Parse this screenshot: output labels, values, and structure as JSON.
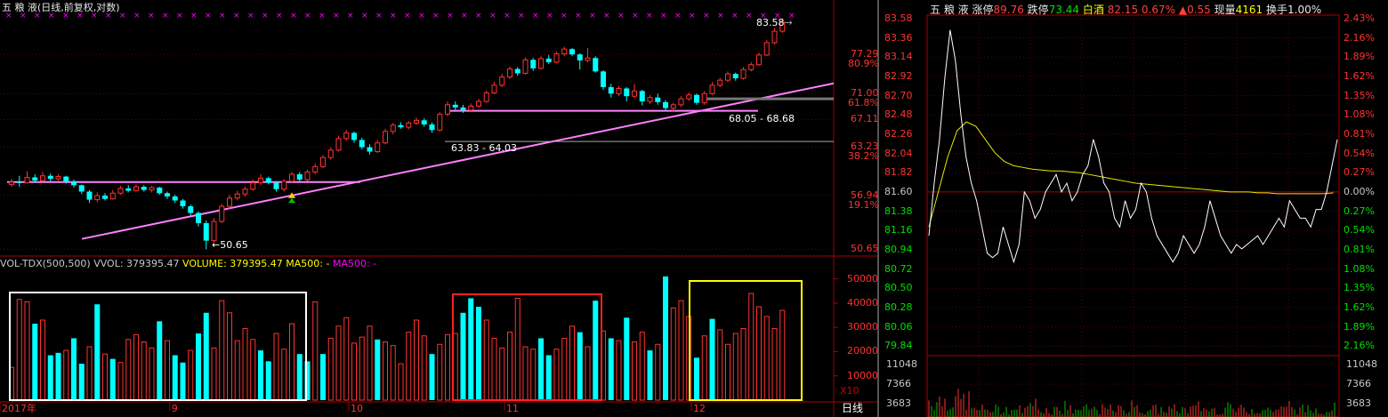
{
  "header": {
    "stock": "五 粮 液",
    "mode": "(日线,前复权,对数)"
  },
  "kline": {
    "high_label": "83.58",
    "low_label": "50.65",
    "zone1_label": "63.83 - 64.03",
    "zone2_label": "68.05 - 68.68",
    "price_axis": [
      {
        "price": "77.29",
        "pct": "80.9%"
      },
      {
        "price": "71.00",
        "pct": "61.8%"
      },
      {
        "price": "67.11",
        "pct": ""
      },
      {
        "price": "63.23",
        "pct": "38.2%"
      },
      {
        "price": "56.94",
        "pct": "19.1%"
      },
      {
        "price": "50.65",
        "pct": ""
      }
    ],
    "candles": [
      {
        "o": 58.3,
        "c": 58.6,
        "h": 59.0,
        "l": 58.0
      },
      {
        "o": 58.6,
        "c": 58.5,
        "h": 59.4,
        "l": 58.0
      },
      {
        "o": 58.5,
        "c": 59.2,
        "h": 60.0,
        "l": 58.4
      },
      {
        "o": 59.2,
        "c": 58.8,
        "h": 59.6,
        "l": 58.5
      },
      {
        "o": 58.8,
        "c": 59.4,
        "h": 59.9,
        "l": 58.6
      },
      {
        "o": 59.4,
        "c": 59.0,
        "h": 59.7,
        "l": 58.7
      },
      {
        "o": 59.0,
        "c": 59.3,
        "h": 59.6,
        "l": 58.8
      },
      {
        "o": 59.3,
        "c": 58.7,
        "h": 59.4,
        "l": 58.4
      },
      {
        "o": 58.7,
        "c": 58.2,
        "h": 58.9,
        "l": 57.9
      },
      {
        "o": 58.2,
        "c": 57.4,
        "h": 58.3,
        "l": 57.1
      },
      {
        "o": 57.4,
        "c": 56.4,
        "h": 57.6,
        "l": 56.0
      },
      {
        "o": 56.4,
        "c": 56.9,
        "h": 57.3,
        "l": 56.1
      },
      {
        "o": 56.9,
        "c": 56.5,
        "h": 57.2,
        "l": 56.3
      },
      {
        "o": 56.5,
        "c": 57.2,
        "h": 57.6,
        "l": 56.4
      },
      {
        "o": 57.2,
        "c": 57.8,
        "h": 58.1,
        "l": 57.0
      },
      {
        "o": 57.8,
        "c": 57.5,
        "h": 58.2,
        "l": 57.3
      },
      {
        "o": 57.5,
        "c": 58.0,
        "h": 58.3,
        "l": 57.4
      },
      {
        "o": 58.0,
        "c": 57.6,
        "h": 58.2,
        "l": 57.4
      },
      {
        "o": 57.6,
        "c": 57.9,
        "h": 58.1,
        "l": 57.3
      },
      {
        "o": 57.9,
        "c": 57.2,
        "h": 58.0,
        "l": 57.0
      },
      {
        "o": 57.2,
        "c": 56.8,
        "h": 57.4,
        "l": 56.5
      },
      {
        "o": 56.8,
        "c": 56.3,
        "h": 57.0,
        "l": 56.0
      },
      {
        "o": 56.3,
        "c": 55.6,
        "h": 56.5,
        "l": 55.3
      },
      {
        "o": 55.6,
        "c": 54.8,
        "h": 55.8,
        "l": 54.5
      },
      {
        "o": 54.8,
        "c": 53.6,
        "h": 55.0,
        "l": 53.2
      },
      {
        "o": 53.6,
        "c": 51.6,
        "h": 53.9,
        "l": 50.65
      },
      {
        "o": 51.6,
        "c": 53.8,
        "h": 54.2,
        "l": 51.4
      },
      {
        "o": 53.8,
        "c": 55.6,
        "h": 55.9,
        "l": 53.6
      },
      {
        "o": 55.6,
        "c": 56.6,
        "h": 57.0,
        "l": 55.3
      },
      {
        "o": 56.6,
        "c": 57.1,
        "h": 57.5,
        "l": 56.3
      },
      {
        "o": 57.1,
        "c": 57.7,
        "h": 58.0,
        "l": 56.8
      },
      {
        "o": 57.7,
        "c": 58.5,
        "h": 58.9,
        "l": 57.5
      },
      {
        "o": 58.5,
        "c": 59.1,
        "h": 59.6,
        "l": 58.2
      },
      {
        "o": 59.1,
        "c": 58.5,
        "h": 59.3,
        "l": 58.3
      },
      {
        "o": 58.5,
        "c": 57.7,
        "h": 58.7,
        "l": 57.4
      },
      {
        "o": 57.7,
        "c": 58.7,
        "h": 59.0,
        "l": 57.4
      },
      {
        "o": 58.7,
        "c": 59.6,
        "h": 59.9,
        "l": 58.5
      },
      {
        "o": 59.6,
        "c": 58.9,
        "h": 59.9,
        "l": 58.6
      },
      {
        "o": 58.9,
        "c": 59.9,
        "h": 60.2,
        "l": 58.7
      },
      {
        "o": 59.9,
        "c": 60.6,
        "h": 61.0,
        "l": 59.6
      },
      {
        "o": 60.6,
        "c": 61.8,
        "h": 62.1,
        "l": 60.4
      },
      {
        "o": 61.8,
        "c": 62.8,
        "h": 63.2,
        "l": 61.5
      },
      {
        "o": 62.8,
        "c": 64.4,
        "h": 64.8,
        "l": 62.6
      },
      {
        "o": 64.4,
        "c": 65.2,
        "h": 65.6,
        "l": 64.1
      },
      {
        "o": 65.2,
        "c": 64.2,
        "h": 65.4,
        "l": 63.8
      },
      {
        "o": 64.2,
        "c": 63.2,
        "h": 64.5,
        "l": 62.9
      },
      {
        "o": 63.2,
        "c": 62.6,
        "h": 63.6,
        "l": 62.2
      },
      {
        "o": 62.6,
        "c": 63.8,
        "h": 64.2,
        "l": 62.4
      },
      {
        "o": 63.8,
        "c": 65.4,
        "h": 65.8,
        "l": 63.6
      },
      {
        "o": 65.4,
        "c": 66.3,
        "h": 66.6,
        "l": 65.0
      },
      {
        "o": 66.3,
        "c": 66.0,
        "h": 66.7,
        "l": 65.8
      },
      {
        "o": 66.0,
        "c": 66.6,
        "h": 66.9,
        "l": 65.7
      },
      {
        "o": 66.6,
        "c": 67.0,
        "h": 67.4,
        "l": 66.3
      },
      {
        "o": 67.0,
        "c": 66.4,
        "h": 67.3,
        "l": 66.1
      },
      {
        "o": 66.4,
        "c": 65.6,
        "h": 66.7,
        "l": 65.2
      },
      {
        "o": 65.6,
        "c": 67.9,
        "h": 68.2,
        "l": 65.4
      },
      {
        "o": 67.9,
        "c": 69.3,
        "h": 69.8,
        "l": 67.6
      },
      {
        "o": 69.3,
        "c": 68.9,
        "h": 69.8,
        "l": 68.5
      },
      {
        "o": 68.9,
        "c": 68.5,
        "h": 69.3,
        "l": 68.1
      },
      {
        "o": 68.5,
        "c": 69.1,
        "h": 69.5,
        "l": 68.2
      },
      {
        "o": 69.1,
        "c": 69.8,
        "h": 70.2,
        "l": 68.9
      },
      {
        "o": 69.8,
        "c": 71.1,
        "h": 71.5,
        "l": 69.6
      },
      {
        "o": 71.1,
        "c": 72.3,
        "h": 72.8,
        "l": 70.9
      },
      {
        "o": 72.3,
        "c": 73.6,
        "h": 74.1,
        "l": 72.0
      },
      {
        "o": 73.6,
        "c": 74.9,
        "h": 75.3,
        "l": 73.3
      },
      {
        "o": 74.9,
        "c": 74.2,
        "h": 75.2,
        "l": 73.8
      },
      {
        "o": 74.2,
        "c": 76.4,
        "h": 76.8,
        "l": 74.0
      },
      {
        "o": 76.4,
        "c": 75.0,
        "h": 76.7,
        "l": 74.6
      },
      {
        "o": 75.0,
        "c": 76.6,
        "h": 77.0,
        "l": 74.8
      },
      {
        "o": 76.6,
        "c": 76.0,
        "h": 77.2,
        "l": 75.7
      },
      {
        "o": 76.0,
        "c": 77.4,
        "h": 77.8,
        "l": 75.8
      },
      {
        "o": 77.4,
        "c": 78.2,
        "h": 78.6,
        "l": 77.0
      },
      {
        "o": 78.2,
        "c": 77.3,
        "h": 78.4,
        "l": 77.0
      },
      {
        "o": 77.3,
        "c": 76.3,
        "h": 77.5,
        "l": 74.8
      },
      {
        "o": 76.3,
        "c": 76.7,
        "h": 78.4,
        "l": 76.0
      },
      {
        "o": 76.7,
        "c": 74.5,
        "h": 77.0,
        "l": 74.3
      },
      {
        "o": 74.5,
        "c": 72.0,
        "h": 74.7,
        "l": 71.6
      },
      {
        "o": 72.0,
        "c": 71.0,
        "h": 72.5,
        "l": 70.4
      },
      {
        "o": 71.0,
        "c": 71.8,
        "h": 72.2,
        "l": 70.6
      },
      {
        "o": 71.8,
        "c": 70.6,
        "h": 72.0,
        "l": 69.8
      },
      {
        "o": 70.6,
        "c": 71.4,
        "h": 72.5,
        "l": 70.3
      },
      {
        "o": 71.4,
        "c": 69.8,
        "h": 71.6,
        "l": 69.2
      },
      {
        "o": 69.8,
        "c": 70.4,
        "h": 70.8,
        "l": 69.4
      },
      {
        "o": 70.4,
        "c": 69.7,
        "h": 71.0,
        "l": 69.3
      },
      {
        "o": 69.7,
        "c": 68.8,
        "h": 70.0,
        "l": 68.3
      },
      {
        "o": 68.8,
        "c": 69.3,
        "h": 69.6,
        "l": 68.2
      },
      {
        "o": 69.3,
        "c": 70.2,
        "h": 70.6,
        "l": 69.0
      },
      {
        "o": 70.2,
        "c": 70.8,
        "h": 71.2,
        "l": 69.9
      },
      {
        "o": 70.8,
        "c": 69.6,
        "h": 71.0,
        "l": 69.3
      },
      {
        "o": 69.6,
        "c": 71.0,
        "h": 71.4,
        "l": 69.3
      },
      {
        "o": 71.0,
        "c": 72.3,
        "h": 72.8,
        "l": 70.8
      },
      {
        "o": 72.3,
        "c": 73.1,
        "h": 73.5,
        "l": 72.0
      },
      {
        "o": 73.1,
        "c": 74.1,
        "h": 74.5,
        "l": 72.8
      },
      {
        "o": 74.1,
        "c": 73.4,
        "h": 74.3,
        "l": 73.0
      },
      {
        "o": 73.4,
        "c": 74.8,
        "h": 75.2,
        "l": 73.2
      },
      {
        "o": 74.8,
        "c": 75.6,
        "h": 76.0,
        "l": 74.5
      },
      {
        "o": 75.6,
        "c": 77.2,
        "h": 77.6,
        "l": 75.4
      },
      {
        "o": 77.2,
        "c": 79.3,
        "h": 79.8,
        "l": 77.0
      },
      {
        "o": 79.3,
        "c": 81.3,
        "h": 81.8,
        "l": 79.0
      },
      {
        "o": 81.3,
        "c": 82.9,
        "h": 83.58,
        "l": 81.0
      }
    ]
  },
  "volume": {
    "title": "VOL-TDX(500,500)",
    "vvol": "VVOL: 379395.47",
    "volume": "VOLUME: 379395.47",
    "ma1": "MA500: -",
    "ma2": "MA500: -",
    "axis": [
      "50000",
      "40000",
      "30000",
      "20000",
      "10000"
    ],
    "unit": "X10",
    "bars": [
      {
        "v": 13500,
        "u": 1
      },
      {
        "v": 41500,
        "u": 1
      },
      {
        "v": 40500,
        "u": 1
      },
      {
        "v": 31500,
        "u": 0
      },
      {
        "v": 33000,
        "u": 1
      },
      {
        "v": 18500,
        "u": 0
      },
      {
        "v": 19500,
        "u": 0
      },
      {
        "v": 20500,
        "u": 1
      },
      {
        "v": 25500,
        "u": 0
      },
      {
        "v": 15000,
        "u": 0
      },
      {
        "v": 22000,
        "u": 1
      },
      {
        "v": 39500,
        "u": 0
      },
      {
        "v": 19000,
        "u": 1
      },
      {
        "v": 17000,
        "u": 0
      },
      {
        "v": 15500,
        "u": 1
      },
      {
        "v": 25000,
        "u": 1
      },
      {
        "v": 27000,
        "u": 1
      },
      {
        "v": 24000,
        "u": 1
      },
      {
        "v": 21500,
        "u": 1
      },
      {
        "v": 32500,
        "u": 0
      },
      {
        "v": 24500,
        "u": 1
      },
      {
        "v": 18500,
        "u": 0
      },
      {
        "v": 15500,
        "u": 0
      },
      {
        "v": 20500,
        "u": 1
      },
      {
        "v": 27500,
        "u": 0
      },
      {
        "v": 36000,
        "u": 0
      },
      {
        "v": 21500,
        "u": 1
      },
      {
        "v": 41000,
        "u": 1
      },
      {
        "v": 36000,
        "u": 1
      },
      {
        "v": 24500,
        "u": 1
      },
      {
        "v": 29500,
        "u": 1
      },
      {
        "v": 25000,
        "u": 1
      },
      {
        "v": 20500,
        "u": 0
      },
      {
        "v": 16000,
        "u": 0
      },
      {
        "v": 27500,
        "u": 1
      },
      {
        "v": 21000,
        "u": 1
      },
      {
        "v": 31500,
        "u": 1
      },
      {
        "v": 19000,
        "u": 0
      },
      {
        "v": 16000,
        "u": 0
      },
      {
        "v": 40500,
        "u": 1
      },
      {
        "v": 19000,
        "u": 0
      },
      {
        "v": 25500,
        "u": 1
      },
      {
        "v": 30500,
        "u": 1
      },
      {
        "v": 34000,
        "u": 1
      },
      {
        "v": 23500,
        "u": 1
      },
      {
        "v": 26000,
        "u": 1
      },
      {
        "v": 30500,
        "u": 1
      },
      {
        "v": 25000,
        "u": 0
      },
      {
        "v": 24000,
        "u": 1
      },
      {
        "v": 22500,
        "u": 1
      },
      {
        "v": 15000,
        "u": 1
      },
      {
        "v": 28000,
        "u": 1
      },
      {
        "v": 33000,
        "u": 1
      },
      {
        "v": 26500,
        "u": 1
      },
      {
        "v": 19000,
        "u": 0
      },
      {
        "v": 23000,
        "u": 1
      },
      {
        "v": 27000,
        "u": 1
      },
      {
        "v": 27500,
        "u": 1
      },
      {
        "v": 36000,
        "u": 0
      },
      {
        "v": 42000,
        "u": 0
      },
      {
        "v": 38500,
        "u": 0
      },
      {
        "v": 33000,
        "u": 1
      },
      {
        "v": 25500,
        "u": 1
      },
      {
        "v": 21500,
        "u": 1
      },
      {
        "v": 28000,
        "u": 1
      },
      {
        "v": 42000,
        "u": 1
      },
      {
        "v": 22000,
        "u": 1
      },
      {
        "v": 21000,
        "u": 1
      },
      {
        "v": 25500,
        "u": 0
      },
      {
        "v": 18500,
        "u": 0
      },
      {
        "v": 21000,
        "u": 1
      },
      {
        "v": 25500,
        "u": 1
      },
      {
        "v": 30500,
        "u": 1
      },
      {
        "v": 28000,
        "u": 0
      },
      {
        "v": 22000,
        "u": 1
      },
      {
        "v": 41000,
        "u": 0
      },
      {
        "v": 28500,
        "u": 1
      },
      {
        "v": 25500,
        "u": 0
      },
      {
        "v": 24500,
        "u": 1
      },
      {
        "v": 34000,
        "u": 0
      },
      {
        "v": 24000,
        "u": 1
      },
      {
        "v": 28000,
        "u": 1
      },
      {
        "v": 20500,
        "u": 0
      },
      {
        "v": 23000,
        "u": 1
      },
      {
        "v": 51000,
        "u": 0
      },
      {
        "v": 38000,
        "u": 1
      },
      {
        "v": 41000,
        "u": 1
      },
      {
        "v": 34500,
        "u": 1
      },
      {
        "v": 17500,
        "u": 0
      },
      {
        "v": 26500,
        "u": 1
      },
      {
        "v": 33500,
        "u": 0
      },
      {
        "v": 29000,
        "u": 1
      },
      {
        "v": 23000,
        "u": 1
      },
      {
        "v": 27500,
        "u": 1
      },
      {
        "v": 29500,
        "u": 1
      },
      {
        "v": 44000,
        "u": 1
      },
      {
        "v": 38500,
        "u": 1
      },
      {
        "v": 34500,
        "u": 1
      },
      {
        "v": 29500,
        "u": 1
      },
      {
        "v": 37000,
        "u": 1
      }
    ]
  },
  "date_axis": [
    {
      "label": "2017年",
      "col": 0
    },
    {
      "label": "9",
      "col": 21
    },
    {
      "label": "10",
      "col": 44
    },
    {
      "label": "11",
      "col": 64
    },
    {
      "label": "12",
      "col": 88
    }
  ],
  "period_button": "日线",
  "intraday": {
    "header": {
      "stock": "五 粮 液",
      "limit_up_label": "涨停",
      "limit_up": "89.76",
      "limit_down_label": "跌停",
      "limit_down": "73.44",
      "sector": "白酒",
      "price": "82.15",
      "change_pct": "0.67%",
      "change": "▲0.55",
      "cur_vol_label": "现量",
      "cur_vol": "4161",
      "turnover_label": "换手",
      "turnover": "1.00%"
    },
    "left_axis": [
      "83.58",
      "83.36",
      "83.14",
      "82.92",
      "82.70",
      "82.48",
      "82.26",
      "82.04",
      "81.82",
      "81.60",
      "81.38",
      "81.16",
      "80.94",
      "80.72",
      "80.50",
      "80.28",
      "80.06",
      "79.84"
    ],
    "right_axis": [
      "2.43%",
      "2.16%",
      "1.89%",
      "1.62%",
      "1.35%",
      "1.08%",
      "0.81%",
      "0.54%",
      "0.27%",
      "0.00%",
      "0.27%",
      "0.54%",
      "0.81%",
      "1.08%",
      "1.35%",
      "1.62%",
      "1.89%",
      "2.16%"
    ],
    "vol_axis": [
      "11048",
      "7366",
      "3683"
    ],
    "price_series": [
      81.1,
      81.7,
      82.2,
      82.9,
      83.45,
      83.1,
      82.5,
      82.0,
      81.7,
      81.5,
      81.2,
      80.9,
      80.85,
      80.9,
      81.2,
      81.0,
      80.8,
      81.0,
      81.6,
      81.5,
      81.3,
      81.4,
      81.6,
      81.7,
      81.8,
      81.6,
      81.7,
      81.5,
      81.6,
      81.8,
      81.9,
      82.2,
      82.0,
      81.7,
      81.6,
      81.3,
      81.2,
      81.5,
      81.3,
      81.4,
      81.7,
      81.6,
      81.3,
      81.1,
      81.0,
      80.9,
      80.8,
      80.9,
      81.1,
      81.0,
      80.9,
      81.0,
      81.2,
      81.5,
      81.3,
      81.1,
      81.0,
      80.9,
      81.0,
      80.95,
      81.0,
      81.05,
      81.1,
      81.0,
      81.1,
      81.2,
      81.3,
      81.2,
      81.5,
      81.4,
      81.3,
      81.3,
      81.2,
      81.4,
      81.4,
      81.6,
      81.9,
      82.2
    ],
    "avg_series": [
      81.2,
      81.6,
      82.0,
      82.3,
      82.4,
      82.35,
      82.2,
      82.05,
      81.95,
      81.9,
      81.88,
      81.86,
      81.85,
      81.84,
      81.84,
      81.83,
      81.82,
      81.8,
      81.78,
      81.76,
      81.74,
      81.72,
      81.7,
      81.69,
      81.68,
      81.67,
      81.66,
      81.65,
      81.64,
      81.63,
      81.62,
      81.61,
      81.6,
      81.6,
      81.6,
      81.59,
      81.59,
      81.58,
      81.58,
      81.58,
      81.58,
      81.58,
      81.58,
      81.59
    ]
  }
}
